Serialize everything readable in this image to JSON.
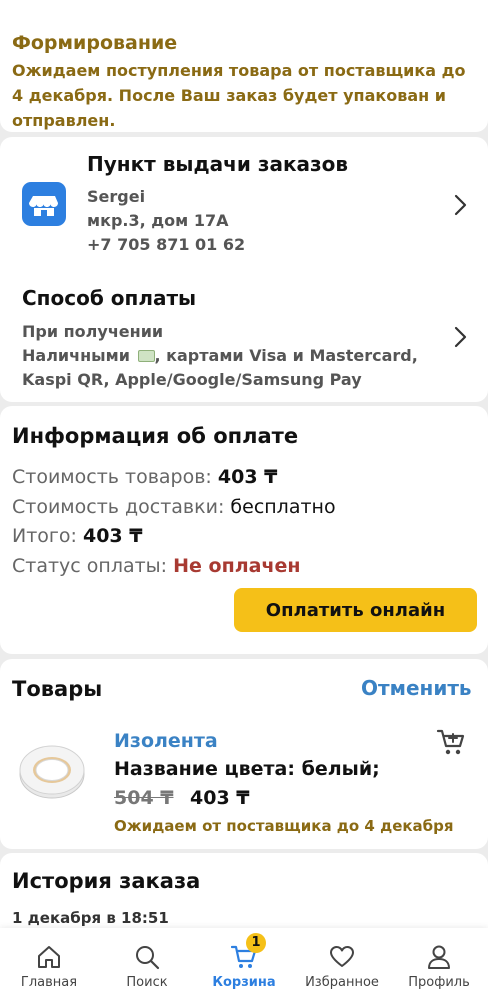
{
  "header": {
    "cut_title": "...",
    "status_title": "Формирование",
    "status_text": "Ожидаем поступления товара от поставщика до 4 декабря. После Ваш заказ будет упакован и отправлен."
  },
  "pickup": {
    "title": "Пункт выдачи заказов",
    "name": "Sergei",
    "address": "мкр.3, дом 17А",
    "phone": "+7 705 871 01 62",
    "icon": "store-icon"
  },
  "payment_method": {
    "title": "Способ оплаты",
    "line1": "При получении",
    "line2_a": "Наличными",
    "line2_b": ", картами Visa и Mastercard,",
    "line3": "Kaspi QR, Apple/Google/Samsung Pay"
  },
  "payment_info": {
    "title": "Информация об оплате",
    "goods_label": "Стоимость товаров:",
    "goods_value": "403 ₸",
    "delivery_label": "Стоимость доставки:",
    "delivery_value": "бесплатно",
    "total_label": "Итого:",
    "total_value": "403 ₸",
    "status_label": "Статус оплаты:",
    "status_value": "Не оплачен",
    "pay_button": "Оплатить онлайн"
  },
  "goods": {
    "title": "Товары",
    "cancel": "Отменить",
    "item": {
      "name": "Изолента",
      "color": "Название цвета: белый;",
      "old_price": "504 ₸",
      "price": "403 ₸",
      "eta": "Ожидаем от поставщика до 4 декабря"
    }
  },
  "history": {
    "title": "История заказа",
    "date": "1 декабря в 18:51"
  },
  "nav": {
    "items": [
      {
        "label": "Главная",
        "icon": "home-icon"
      },
      {
        "label": "Поиск",
        "icon": "search-icon"
      },
      {
        "label": "Корзина",
        "icon": "cart-icon",
        "badge": "1"
      },
      {
        "label": "Избранное",
        "icon": "heart-icon"
      },
      {
        "label": "Профиль",
        "icon": "profile-icon"
      }
    ]
  },
  "colors": {
    "accent": "#2d7fe0",
    "brand_yellow": "#f5c018",
    "status_brown": "#8a6a14",
    "unpaid_red": "#a83a32",
    "link_blue": "#3a82c4"
  }
}
